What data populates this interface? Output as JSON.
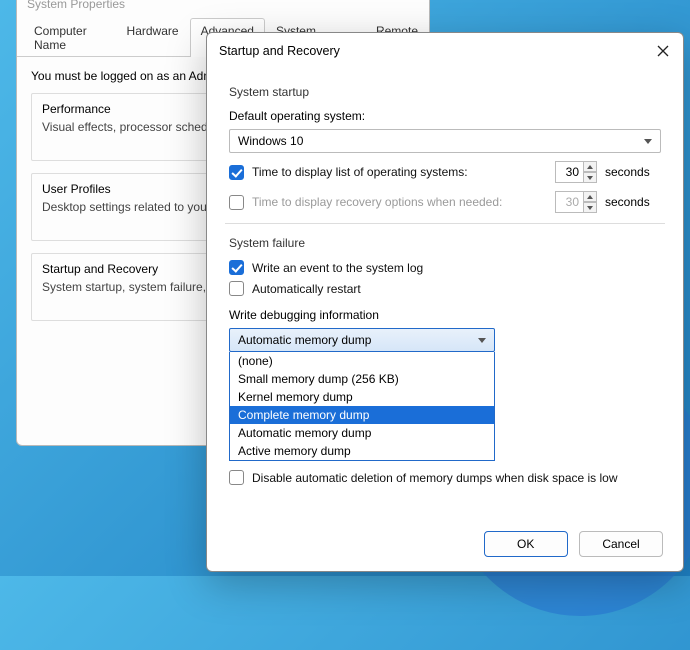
{
  "sysprop": {
    "title": "System Properties",
    "tabs": [
      "Computer Name",
      "Hardware",
      "Advanced",
      "System Protection",
      "Remote"
    ],
    "active_tab": 2,
    "notice": "You must be logged on as an Admi",
    "groups": [
      {
        "title": "Performance",
        "desc": "Visual effects, processor scheduli"
      },
      {
        "title": "User Profiles",
        "desc": "Desktop settings related to your s"
      },
      {
        "title": "Startup and Recovery",
        "desc": "System startup, system failure, and"
      }
    ]
  },
  "startup": {
    "title": "Startup and Recovery",
    "section1": "System startup",
    "default_os_label": "Default operating system:",
    "default_os_value": "Windows 10",
    "show_os_list_checked": true,
    "show_os_list_label": "Time to display list of operating systems:",
    "show_os_list_value": "30",
    "show_recovery_checked": false,
    "show_recovery_label": "Time to display recovery options when needed:",
    "show_recovery_value": "30",
    "seconds_label": "seconds",
    "section2": "System failure",
    "write_event_checked": true,
    "write_event_label": "Write an event to the system log",
    "auto_restart_checked": false,
    "auto_restart_label": "Automatically restart",
    "dump_label": "Write debugging information",
    "dump_selected": "Automatic memory dump",
    "dump_options": [
      "(none)",
      "Small memory dump (256 KB)",
      "Kernel memory dump",
      "Complete memory dump",
      "Automatic memory dump",
      "Active memory dump"
    ],
    "dump_highlight_index": 3,
    "disable_delete_label": "Disable automatic deletion of memory dumps when disk space is low",
    "ok_label": "OK",
    "cancel_label": "Cancel"
  }
}
